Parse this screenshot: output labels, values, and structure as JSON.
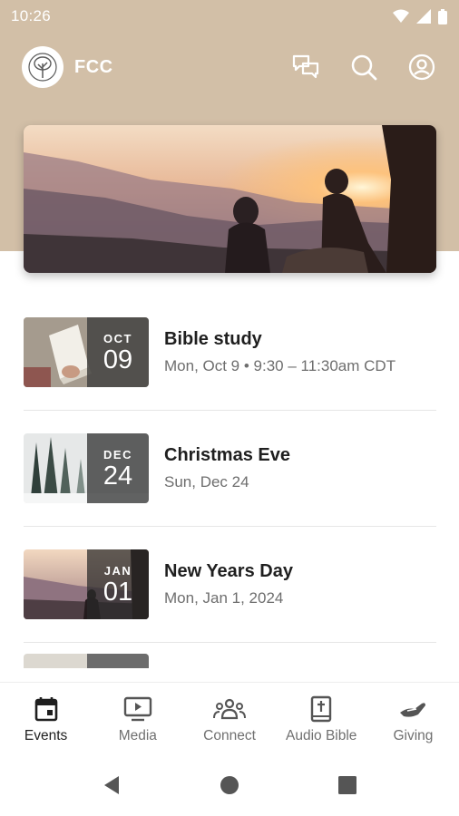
{
  "status_bar": {
    "time": "10:26"
  },
  "header": {
    "app_name": "FCC"
  },
  "events": [
    {
      "month": "OCT",
      "day": "09",
      "title": "Bible study",
      "subtitle": "Mon, Oct 9 • 9:30 – 11:30am CDT"
    },
    {
      "month": "DEC",
      "day": "24",
      "title": "Christmas Eve",
      "subtitle": "Sun, Dec 24"
    },
    {
      "month": "JAN",
      "day": "01",
      "title": "New Years Day",
      "subtitle": "Mon, Jan 1, 2024"
    }
  ],
  "bottom_nav": [
    {
      "label": "Events",
      "icon": "calendar-icon",
      "active": true
    },
    {
      "label": "Media",
      "icon": "play-screen-icon",
      "active": false
    },
    {
      "label": "Connect",
      "icon": "people-group-icon",
      "active": false
    },
    {
      "label": "Audio Bible",
      "icon": "bible-icon",
      "active": false
    },
    {
      "label": "Giving",
      "icon": "giving-hand-icon",
      "active": false
    }
  ],
  "colors": {
    "header_band": "#d2bfa7",
    "accent_text": "#1f1f1f",
    "muted_text": "#6e6e6e"
  }
}
